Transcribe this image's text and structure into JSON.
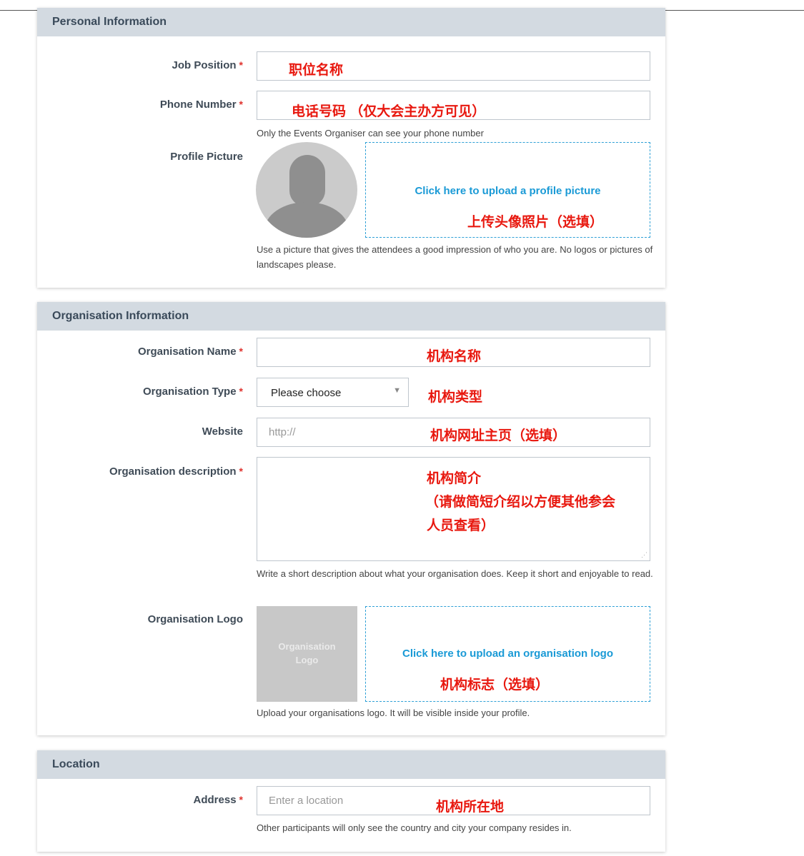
{
  "personal": {
    "header": "Personal Information",
    "job_position": {
      "label": "Job Position",
      "required_mark": "*",
      "annotation": "职位名称"
    },
    "phone_number": {
      "label": "Phone Number",
      "required_mark": "*",
      "annotation": "电话号码 （仅大会主办方可见）",
      "help": "Only the Events Organiser can see your phone number"
    },
    "profile_picture": {
      "label": "Profile Picture",
      "upload_link": "Click here to upload a profile picture",
      "annotation": "上传头像照片（选填）",
      "help": "Use a picture that gives the attendees a good impression of who you are. No logos or pictures of landscapes please."
    }
  },
  "organisation": {
    "header": "Organisation Information",
    "name": {
      "label": "Organisation Name",
      "required_mark": "*",
      "annotation": "机构名称"
    },
    "type": {
      "label": "Organisation Type",
      "required_mark": "*",
      "selected": "Please choose",
      "annotation": "机构类型"
    },
    "website": {
      "label": "Website",
      "placeholder": "http://",
      "annotation": "机构网址主页（选填）"
    },
    "description": {
      "label": "Organisation description",
      "required_mark": "*",
      "annotation_line1": "机构简介",
      "annotation_line2": "（请做简短介绍以方便其他参会",
      "annotation_line3": "人员查看）",
      "help": "Write a short description about what your organisation does. Keep it short and enjoyable to read."
    },
    "logo": {
      "label": "Organisation Logo",
      "placeholder_line1": "Organisation",
      "placeholder_line2": "Logo",
      "upload_link": "Click here to upload an organisation logo",
      "annotation": "机构标志（选填）",
      "help": "Upload your organisations logo. It will be visible inside your profile."
    }
  },
  "location": {
    "header": "Location",
    "address": {
      "label": "Address",
      "required_mark": "*",
      "placeholder": "Enter a location",
      "annotation": "机构所在地",
      "help": "Other participants will only see the country and city your company resides in."
    }
  },
  "icons": {
    "select_arrow": "chevron-down-icon",
    "avatar": "person-silhouette-icon",
    "resize": "resize-handle-icon"
  },
  "colors": {
    "annotation": "#e8180f",
    "link": "#1a9ad6",
    "header_bg": "#d3dae1",
    "required": "#e0332e"
  }
}
